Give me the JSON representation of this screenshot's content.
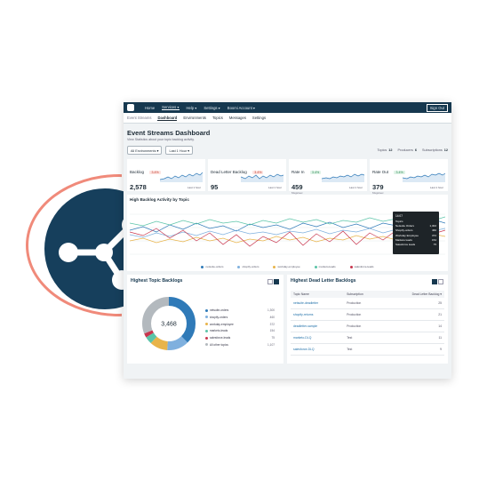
{
  "nav": {
    "items": [
      "Home",
      "Services ▾",
      "Help ▾",
      "Settings ▾",
      "Boomi Account ▾"
    ],
    "signout": "Sign Out"
  },
  "subnav": {
    "crumb": "Event Streams",
    "tabs": [
      "Dashboard",
      "Environments",
      "Topics",
      "Messages",
      "Settings"
    ]
  },
  "dashboard": {
    "title": "Event Streams Dashboard",
    "subtitle": "View Statistics about your topic backlog activity.",
    "env_filter": "All Environments ▾",
    "time_filter": "Last 1 Hour ▾",
    "counts": [
      {
        "label": "Topics",
        "value": "12"
      },
      {
        "label": "Producers",
        "value": "6"
      },
      {
        "label": "Subscriptions",
        "value": "12"
      }
    ]
  },
  "kpis": [
    {
      "label": "Backlog",
      "delta": "3.4%",
      "value": "2,578",
      "unit": "",
      "note": "Last 1 hour",
      "color": "#2f7ab8"
    },
    {
      "label": "Dead Letter Backlog",
      "delta": "3.4%",
      "value": "95",
      "unit": "",
      "note": "Last 1 hour",
      "color": "#2f7ab8"
    },
    {
      "label": "Rate In",
      "delta": "3.4%",
      "value": "459",
      "unit": "Msgs/sec",
      "note": "Last 1 hour",
      "color": "#2f7ab8"
    },
    {
      "label": "Rate Out",
      "delta": "3.4%",
      "value": "379",
      "unit": "Msgs/sec",
      "note": "Last 1 hour",
      "color": "#2f7ab8"
    }
  ],
  "activity": {
    "title": "High Backlog Activity by Topic",
    "legend": [
      "netsuite-orders",
      "shopify-orders",
      "workday-employee",
      "marketo-leads",
      "salesforce-leads"
    ],
    "colors": [
      "#2f7ab8",
      "#7fb0de",
      "#e8b44a",
      "#5bc4a8",
      "#c8364e"
    ],
    "tooltip_time": "14:07",
    "tooltip_header": "Topics",
    "tooltip_rows": [
      {
        "name": "Netsuite Orders",
        "value": "1,302"
      },
      {
        "name": "Shopify-orders",
        "value": "460"
      },
      {
        "name": "Workday Employee",
        "value": "372"
      },
      {
        "name": "Marketo leads",
        "value": "154"
      },
      {
        "name": "Salesforce leads",
        "value": "75"
      }
    ]
  },
  "topic_backlogs": {
    "title": "Highest Topic Backlogs",
    "total": "3,468",
    "rows": [
      {
        "name": "netsuite-orders",
        "value": "1,300",
        "color": "#2f7ab8"
      },
      {
        "name": "shopify-orders",
        "value": "460",
        "color": "#7fb0de"
      },
      {
        "name": "workday-employee",
        "value": "372",
        "color": "#e8b44a"
      },
      {
        "name": "marketo-leads",
        "value": "154",
        "color": "#5bc4a8"
      },
      {
        "name": "salesforce-leads",
        "value": "75",
        "color": "#c8364e"
      },
      {
        "name": "All other topics",
        "value": "1,107",
        "color": "#b3b9be"
      }
    ]
  },
  "dead_letter": {
    "title": "Highest Dead Letter Backlogs",
    "headers": [
      "Topic Name",
      "Subscription",
      "Dead Letter Backlog ▾"
    ],
    "rows": [
      {
        "topic": "netsuite-deadletter",
        "sub": "Production",
        "value": "25"
      },
      {
        "topic": "shopify-returns",
        "sub": "Production",
        "value": "21"
      },
      {
        "topic": "deadletter-sample",
        "sub": "Production",
        "value": "14"
      },
      {
        "topic": "marketo-DLQ",
        "sub": "Test",
        "value": "11"
      },
      {
        "topic": "salesforce-DLQ",
        "sub": "Test",
        "value": "9"
      }
    ]
  }
}
